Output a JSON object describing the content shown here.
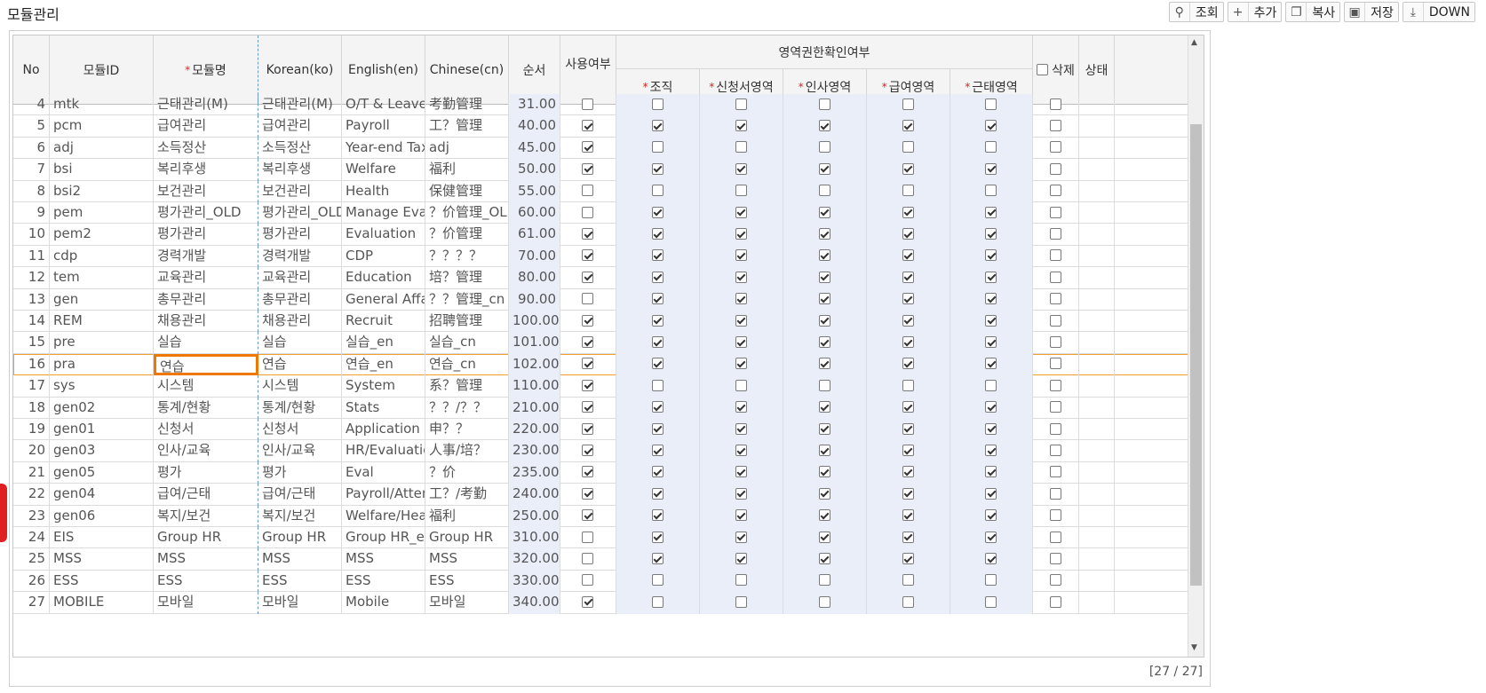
{
  "page": {
    "title": "모듈관리",
    "counter": "[27 / 27]"
  },
  "toolbar": [
    {
      "label": "조회",
      "icon": "search-icon"
    },
    {
      "label": "추가",
      "icon": "plus-icon"
    },
    {
      "label": "복사",
      "icon": "copy-icon"
    },
    {
      "label": "저장",
      "icon": "save-icon"
    },
    {
      "label": "DOWN",
      "icon": "download-icon"
    }
  ],
  "headers": {
    "no": "No",
    "module_id": "모듈ID",
    "module_name": "모듈명",
    "korean": "Korean(ko)",
    "english": "English(en)",
    "chinese": "Chinese(cn)",
    "order": "순서",
    "use": "사용여부",
    "group": "영역권한확인여부",
    "org": "조직",
    "request": "신청서영역",
    "hr": "인사영역",
    "pay": "급여영역",
    "attend": "근태영역",
    "delete": "삭제",
    "status": "상태"
  },
  "rows": [
    {
      "no": "4",
      "id": "mtk",
      "name": "근태관리(M)",
      "ko": "근태관리(M)",
      "en": "O/T & Leave",
      "cn": "考勤管理",
      "order": "31.00",
      "checks": [
        0,
        0,
        0,
        0,
        0,
        0,
        0
      ]
    },
    {
      "no": "5",
      "id": "pcm",
      "name": "급여관리",
      "ko": "급여관리",
      "en": "Payroll",
      "cn": "工？管理",
      "order": "40.00",
      "checks": [
        1,
        1,
        1,
        1,
        1,
        1,
        0
      ]
    },
    {
      "no": "6",
      "id": "adj",
      "name": "소득정산",
      "ko": "소득정산",
      "en": "Year-end Tax A",
      "cn": "adj",
      "order": "45.00",
      "checks": [
        1,
        0,
        0,
        0,
        0,
        0,
        0
      ]
    },
    {
      "no": "7",
      "id": "bsi",
      "name": "복리후생",
      "ko": "복리후생",
      "en": "Welfare",
      "cn": "福利",
      "order": "50.00",
      "checks": [
        1,
        1,
        1,
        1,
        1,
        1,
        0
      ]
    },
    {
      "no": "8",
      "id": "bsi2",
      "name": "보건관리",
      "ko": "보건관리",
      "en": "Health",
      "cn": "保健管理",
      "order": "55.00",
      "checks": [
        0,
        0,
        0,
        0,
        0,
        0,
        0
      ]
    },
    {
      "no": "9",
      "id": "pem",
      "name": "평가관리_OLD",
      "ko": "평가관리_OLD",
      "en": "Manage Eval_",
      "cn": "？价管理_OLD",
      "order": "60.00",
      "checks": [
        0,
        1,
        1,
        1,
        1,
        1,
        0
      ]
    },
    {
      "no": "10",
      "id": "pem2",
      "name": "평가관리",
      "ko": "평가관리",
      "en": "Evaluation",
      "cn": "？价管理",
      "order": "61.00",
      "checks": [
        1,
        1,
        1,
        1,
        1,
        1,
        0
      ]
    },
    {
      "no": "11",
      "id": "cdp",
      "name": "경력개발",
      "ko": "경력개발",
      "en": "CDP",
      "cn": "？？？？",
      "order": "70.00",
      "checks": [
        1,
        1,
        1,
        1,
        1,
        1,
        0
      ]
    },
    {
      "no": "12",
      "id": "tem",
      "name": "교육관리",
      "ko": "교육관리",
      "en": "Education",
      "cn": "培？管理",
      "order": "80.00",
      "checks": [
        1,
        1,
        1,
        1,
        1,
        1,
        0
      ]
    },
    {
      "no": "13",
      "id": "gen",
      "name": "총무관리",
      "ko": "총무관리",
      "en": "General Affair",
      "cn": "？？管理_cn",
      "order": "90.00",
      "checks": [
        0,
        1,
        1,
        1,
        1,
        1,
        0
      ]
    },
    {
      "no": "14",
      "id": "REM",
      "name": "채용관리",
      "ko": "채용관리",
      "en": "Recruit",
      "cn": "招聘管理",
      "order": "100.00",
      "checks": [
        1,
        1,
        1,
        1,
        1,
        1,
        0
      ]
    },
    {
      "no": "15",
      "id": "pre",
      "name": "실습",
      "ko": "실습",
      "en": "실습_en",
      "cn": "실습_cn",
      "order": "101.00",
      "checks": [
        1,
        1,
        1,
        1,
        1,
        1,
        0
      ]
    },
    {
      "no": "16",
      "id": "pra",
      "name": "연습",
      "ko": "연습",
      "en": "연습_en",
      "cn": "연습_cn",
      "order": "102.00",
      "checks": [
        1,
        1,
        1,
        1,
        1,
        1,
        0
      ]
    },
    {
      "no": "17",
      "id": "sys",
      "name": "시스템",
      "ko": "시스템",
      "en": "System",
      "cn": "系？管理",
      "order": "110.00",
      "checks": [
        1,
        0,
        0,
        0,
        0,
        0,
        0
      ]
    },
    {
      "no": "18",
      "id": "gen02",
      "name": "통계/현황",
      "ko": "통계/현황",
      "en": "Stats",
      "cn": "？？/？？",
      "order": "210.00",
      "checks": [
        1,
        1,
        1,
        1,
        1,
        1,
        0
      ]
    },
    {
      "no": "19",
      "id": "gen01",
      "name": "신청서",
      "ko": "신청서",
      "en": "Application",
      "cn": "申？？",
      "order": "220.00",
      "checks": [
        1,
        1,
        1,
        1,
        1,
        1,
        0
      ]
    },
    {
      "no": "20",
      "id": "gen03",
      "name": "인사/교육",
      "ko": "인사/교육",
      "en": "HR/Evaluation",
      "cn": "人事/培？",
      "order": "230.00",
      "checks": [
        1,
        1,
        1,
        1,
        1,
        1,
        0
      ]
    },
    {
      "no": "21",
      "id": "gen05",
      "name": "평가",
      "ko": "평가",
      "en": "Eval",
      "cn": "？价",
      "order": "235.00",
      "checks": [
        1,
        1,
        1,
        1,
        1,
        1,
        0
      ]
    },
    {
      "no": "22",
      "id": "gen04",
      "name": "급여/근태",
      "ko": "급여/근태",
      "en": "Payroll/Attend",
      "cn": "工？/考勤",
      "order": "240.00",
      "checks": [
        1,
        1,
        1,
        1,
        1,
        1,
        0
      ]
    },
    {
      "no": "23",
      "id": "gen06",
      "name": "복지/보건",
      "ko": "복지/보건",
      "en": "Welfare/Health",
      "cn": "福利",
      "order": "250.00",
      "checks": [
        1,
        1,
        1,
        1,
        1,
        1,
        0
      ]
    },
    {
      "no": "24",
      "id": "EIS",
      "name": "Group HR",
      "ko": "Group HR",
      "en": "Group HR_en",
      "cn": "Group HR",
      "order": "310.00",
      "checks": [
        0,
        1,
        1,
        1,
        1,
        1,
        0
      ]
    },
    {
      "no": "25",
      "id": "MSS",
      "name": "MSS",
      "ko": "MSS",
      "en": "MSS",
      "cn": "MSS",
      "order": "320.00",
      "checks": [
        0,
        1,
        1,
        1,
        1,
        1,
        0
      ]
    },
    {
      "no": "26",
      "id": "ESS",
      "name": "ESS",
      "ko": "ESS",
      "en": "ESS",
      "cn": "ESS",
      "order": "330.00",
      "checks": [
        0,
        0,
        0,
        0,
        0,
        0,
        0
      ]
    },
    {
      "no": "27",
      "id": "MOBILE",
      "name": "모바일",
      "ko": "모바일",
      "en": "Mobile",
      "cn": "모바일",
      "order": "340.00",
      "checks": [
        1,
        0,
        0,
        0,
        0,
        0,
        0
      ]
    }
  ],
  "selected_row": "16"
}
